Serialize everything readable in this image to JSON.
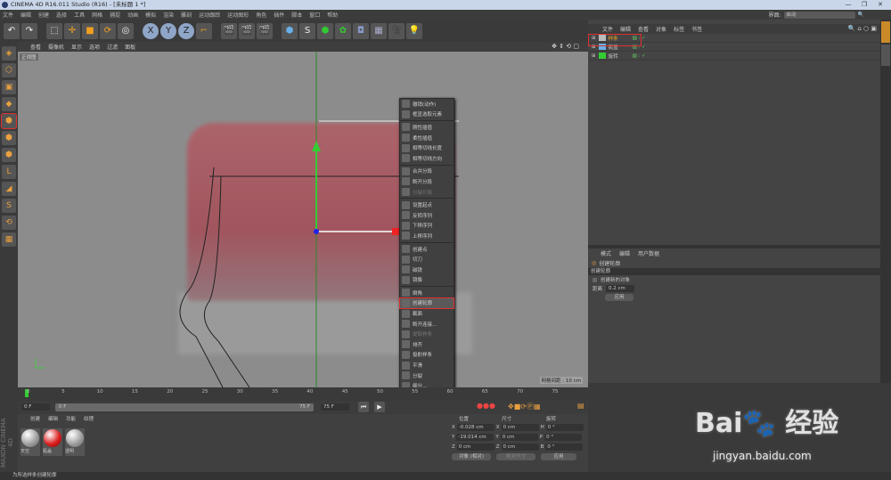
{
  "window": {
    "title": "CINEMA 4D R16.011 Studio (R16) - [未标题 1 *]"
  },
  "menubar": [
    "文件",
    "编辑",
    "创建",
    "选择",
    "工具",
    "网格",
    "捕捉",
    "动画",
    "模拟",
    "渲染",
    "雕刻",
    "运动跟踪",
    "运动图形",
    "角色",
    "插件",
    "脚本",
    "窗口",
    "帮助"
  ],
  "interface": {
    "label": "界面:",
    "value": "启动"
  },
  "toolbar": {
    "x": "X",
    "y": "Y",
    "z": "Z"
  },
  "viewport": {
    "menu": [
      "查看",
      "摄像机",
      "显示",
      "选项",
      "过滤",
      "面板"
    ],
    "label": "正视图",
    "grid_info": "网格间距 : 10 cm"
  },
  "context_menu": {
    "items": [
      "撤销(动作)",
      "框显选取元素",
      "刚性插值",
      "柔性插值",
      "相等切线长度",
      "相等切线方向",
      "合并分段",
      "断开分段",
      "分裂片段",
      "设置起点",
      "反转序列",
      "下移序列",
      "上移序列",
      "创建点",
      "切刀",
      "磁铁",
      "镜像",
      "倒角",
      "创建轮廓",
      "截面",
      "断开连接...",
      "提取样条",
      "排齐",
      "投射样条",
      "平滑",
      "分裂",
      "细分..."
    ],
    "selected": "创建轮廓"
  },
  "object_manager": {
    "tabs": [
      "文件",
      "编辑",
      "查看",
      "对象",
      "标签",
      "书签"
    ],
    "objects": [
      {
        "name": "样条",
        "selected": true
      },
      {
        "name": "瓶盖"
      },
      {
        "name": "旋转"
      }
    ]
  },
  "attributes": {
    "tabs": [
      "模式",
      "编辑",
      "用户数据"
    ],
    "tool_name": "创建轮廓",
    "section": "创建轮廓",
    "checkbox_label": "创建新的对象",
    "distance_label": "距离",
    "distance_value": "0.2 cm",
    "apply": "应用"
  },
  "timeline": {
    "ticks": [
      "0",
      "5",
      "10",
      "15",
      "20",
      "25",
      "30",
      "35",
      "40",
      "45",
      "50",
      "55",
      "60",
      "65",
      "70",
      "75"
    ],
    "current": "0 F",
    "start": "0 F",
    "range_start": "0 F",
    "range_end": "75 F",
    "end": "75 F"
  },
  "materials": {
    "tabs": [
      "创建",
      "编辑",
      "功能",
      "纹理"
    ],
    "items": [
      "天空",
      "瓶盖",
      "透明"
    ]
  },
  "coordinates": {
    "headers": [
      "位置",
      "尺寸",
      "旋转"
    ],
    "rows": [
      [
        "X",
        "-0.028 cm",
        "X",
        "0 cm",
        "H",
        "0 °"
      ],
      [
        "Y",
        "-19.014 cm",
        "Y",
        "0 cm",
        "P",
        "0 °"
      ],
      [
        "Z",
        "0 cm",
        "Z",
        "0 cm",
        "B",
        "0 °"
      ]
    ],
    "mode": "对象 (相对)",
    "size_mode": "绝对尺寸",
    "apply": "应用"
  },
  "status": "为所选样条创建轮廓",
  "brand": "MAXON CINEMA 4D",
  "watermark": {
    "logo": "Bai du 经验",
    "url": "jingyan.baidu.com"
  }
}
